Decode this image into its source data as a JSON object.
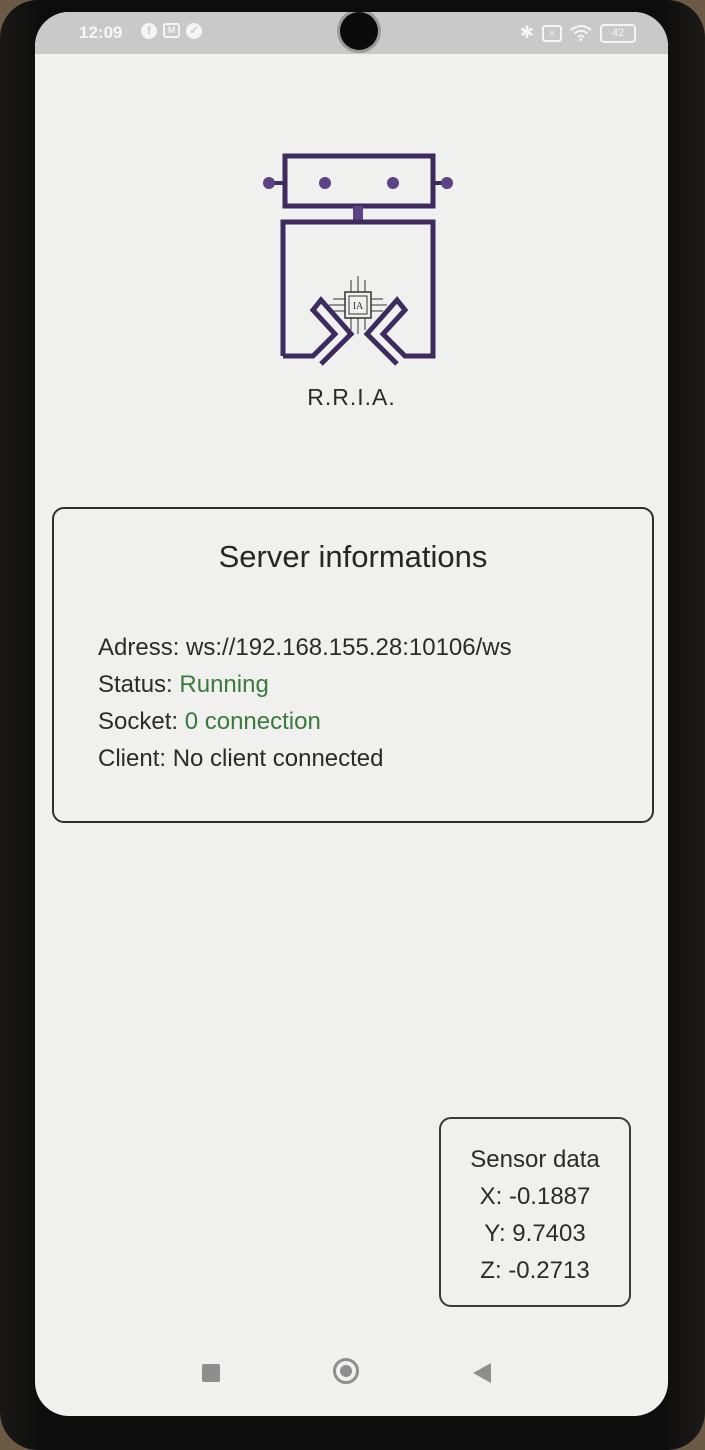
{
  "status_bar": {
    "time": "12:09",
    "left_icons": [
      "notification-f-icon",
      "gmail-icon",
      "check-circle-icon"
    ],
    "right_icons": [
      "bluetooth-icon",
      "sim-no-signal-icon",
      "wifi-icon"
    ],
    "battery": "42"
  },
  "app": {
    "name": "R.R.I.A.",
    "logo_chip_text": "IA",
    "logo_color": "#3d2a5e"
  },
  "server_card": {
    "title": "Server informations",
    "address_label": "Adress:",
    "address_value": "ws://192.168.155.28:10106/ws",
    "status_label": "Status:",
    "status_value": "Running",
    "socket_label": "Socket:",
    "socket_value": "0 connection",
    "client_label": "Client:",
    "client_value": "No client connected",
    "accent_color": "#3b7a3f"
  },
  "sensor_card": {
    "title": "Sensor data",
    "x": "X: -0.1887",
    "y": "Y: 9.7403",
    "z": "Z: -0.2713"
  },
  "nav": {
    "icons": [
      "recents-square-icon",
      "home-circle-icon",
      "back-triangle-icon"
    ]
  }
}
